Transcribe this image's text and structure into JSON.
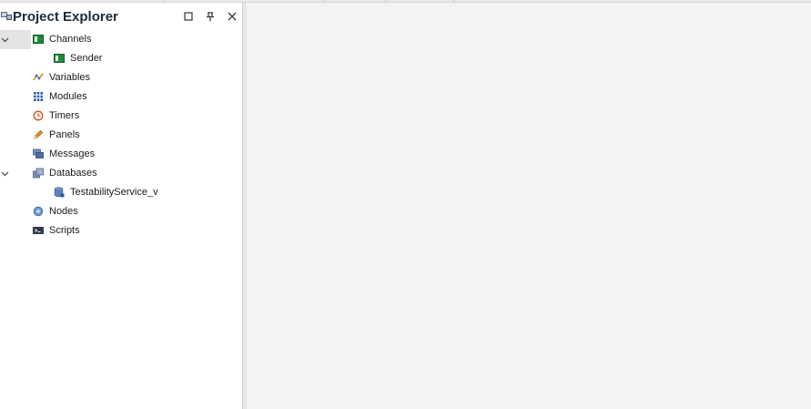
{
  "panel": {
    "title": "Project Explorer",
    "title_icon": "project-explorer-icon",
    "buttons": [
      {
        "name": "maximize-button",
        "icon": "square-icon"
      },
      {
        "name": "pin-button",
        "icon": "pin-icon"
      },
      {
        "name": "close-button",
        "icon": "close-icon"
      }
    ]
  },
  "tree": {
    "items": [
      {
        "label": "Channels",
        "icon": "channel-icon",
        "expanded": true,
        "selected": true
      },
      {
        "label": "Sender",
        "icon": "channel-icon",
        "child": true
      },
      {
        "label": "Variables",
        "icon": "variables-icon"
      },
      {
        "label": "Modules",
        "icon": "modules-grid-icon"
      },
      {
        "label": "Timers",
        "icon": "clock-icon"
      },
      {
        "label": "Panels",
        "icon": "pencil-icon"
      },
      {
        "label": "Messages",
        "icon": "messages-icon"
      },
      {
        "label": "Databases",
        "icon": "database-stack-icon",
        "expanded": true
      },
      {
        "label": "TestabilityService_v",
        "icon": "database-icon",
        "child": true
      },
      {
        "label": "Nodes",
        "icon": "node-icon"
      },
      {
        "label": "Scripts",
        "icon": "script-icon"
      }
    ]
  },
  "colors": {
    "panel_bg": "#ffffff",
    "content_bg": "#f3f3f3",
    "selection": "#e4e4e4",
    "title": "#1e2a3a"
  }
}
